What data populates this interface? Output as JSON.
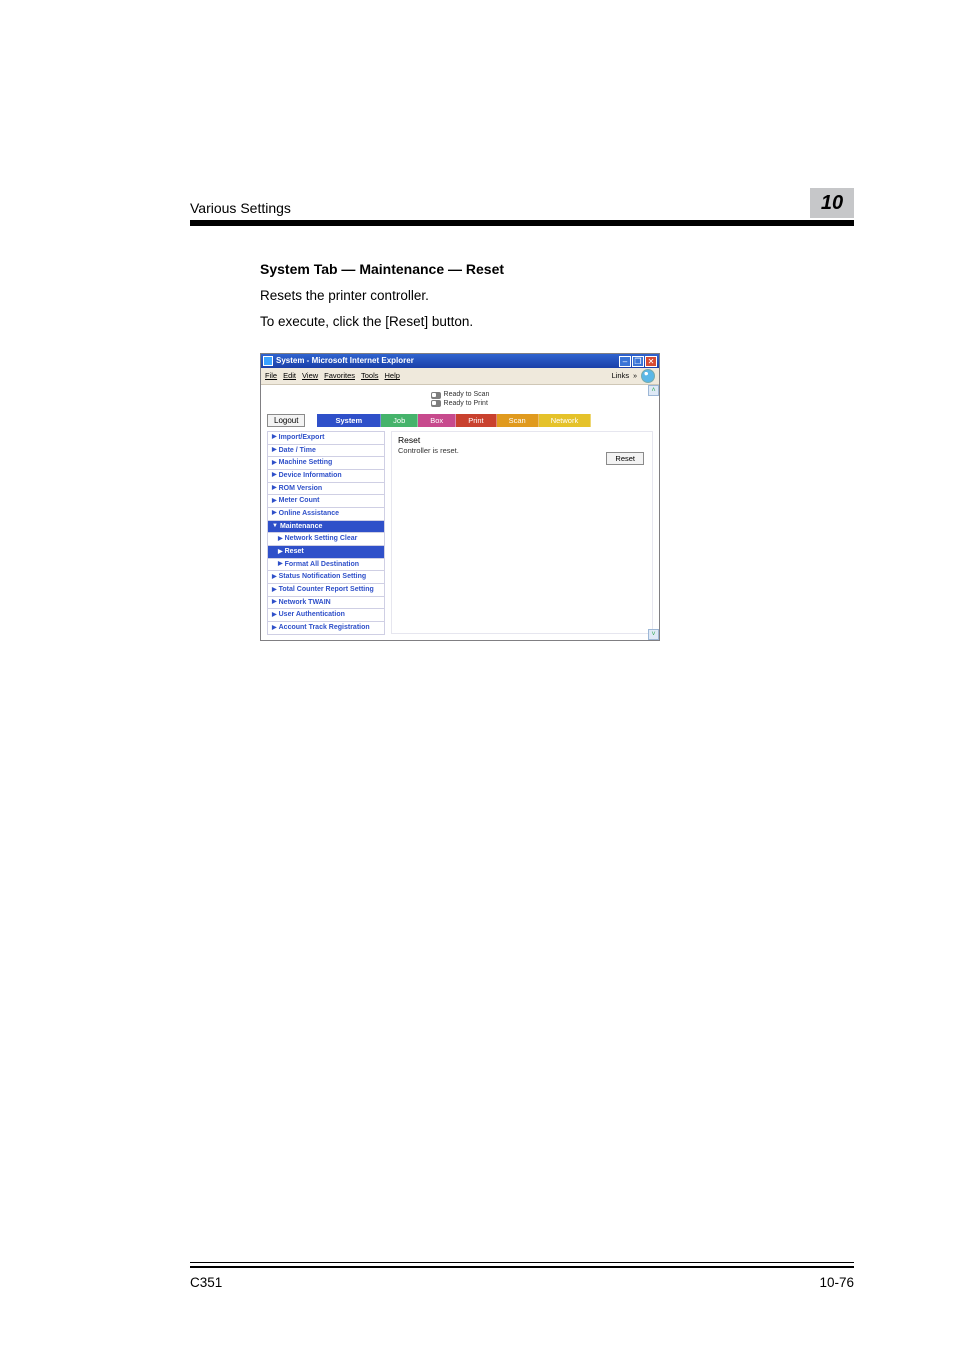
{
  "header": {
    "running_title": "Various Settings",
    "chapter_number": "10"
  },
  "section": {
    "title": "System Tab — Maintenance — Reset",
    "para1": "Resets the printer controller.",
    "para2": "To execute, click the [Reset] button."
  },
  "screenshot": {
    "window_title": "System - Microsoft Internet Explorer",
    "menubar": {
      "file": "File",
      "edit": "Edit",
      "view": "View",
      "favorites": "Favorites",
      "tools": "Tools",
      "help": "Help",
      "links": "Links"
    },
    "status": {
      "scan": "Ready to Scan",
      "print": "Ready to Print"
    },
    "logout_label": "Logout",
    "tabs": {
      "system": "System",
      "job": "Job",
      "box": "Box",
      "print": "Print",
      "scan": "Scan",
      "network": "Network"
    },
    "sidebar": {
      "import_export": "Import/Export",
      "date_time": "Date / Time",
      "machine_setting": "Machine Setting",
      "device_info": "Device Information",
      "rom_version": "ROM Version",
      "meter_count": "Meter Count",
      "online_assist": "Online Assistance",
      "maintenance": "Maintenance",
      "net_setting_clear": "Network Setting Clear",
      "reset": "Reset",
      "format_dest": "Format All Destination",
      "status_notif": "Status Notification Setting",
      "total_counter": "Total Counter Report Setting",
      "net_twain": "Network TWAIN",
      "user_auth": "User Authentication",
      "account_track": "Account Track Registration"
    },
    "main": {
      "heading": "Reset",
      "desc": "Controller is reset.",
      "reset_button": "Reset"
    }
  },
  "footer": {
    "left": "C351",
    "right": "10-76"
  }
}
